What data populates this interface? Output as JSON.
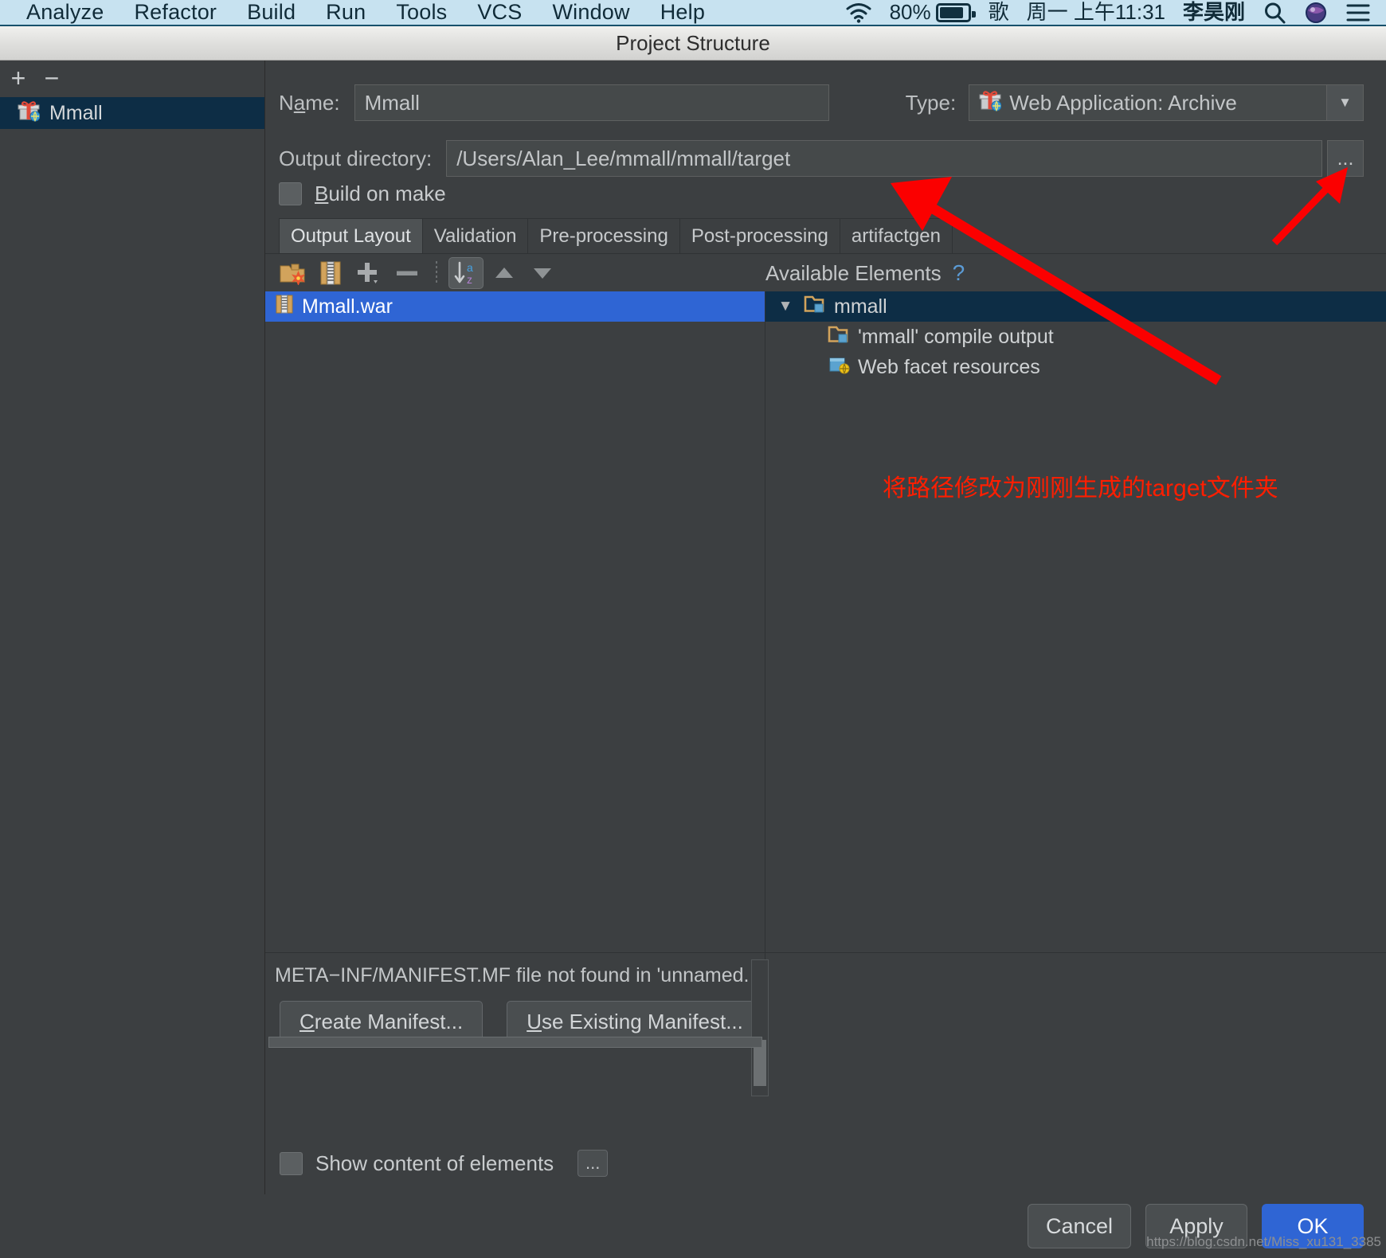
{
  "menubar": {
    "items": [
      {
        "label": "Analyze"
      },
      {
        "label": "Refactor"
      },
      {
        "label": "Build"
      },
      {
        "label": "Run"
      },
      {
        "label": "Tools"
      },
      {
        "label": "VCS"
      },
      {
        "label": "Window"
      },
      {
        "label": "Help"
      }
    ],
    "status": {
      "wifi_icon": "wifi-icon",
      "battery_percent": "80%",
      "battery_icon": "battery-icon",
      "input_method": "歌",
      "datetime": "周一 上午11:31",
      "user": "李昊刚",
      "search_icon": "search-icon",
      "siri_icon": "siri-icon",
      "control_center_icon": "control-center-icon"
    }
  },
  "dialog": {
    "title": "Project Structure",
    "sidebar": {
      "add_label": "+",
      "remove_label": "−",
      "items": [
        {
          "label": "Mmall",
          "icon": "artifact-gift-icon"
        }
      ]
    },
    "form": {
      "name_label_pre": "N",
      "name_label_mnemonic": "a",
      "name_label_post": "me:",
      "name_value": "Mmall",
      "type_label": "Type:",
      "type_value": "Web Application: Archive",
      "type_icon": "artifact-gift-icon",
      "dropdown_icon": "chevron-down-icon",
      "output_label": "Output directory:",
      "output_value": "/Users/Alan_Lee/mmall/mmall/target",
      "browse_label": "...",
      "build_on_make_pre": "",
      "build_on_make_mnemonic": "B",
      "build_on_make_post": "uild on make",
      "build_on_make_checked": false
    },
    "tabs": [
      {
        "label": "Output Layout",
        "active": true
      },
      {
        "label": "Validation",
        "active": false
      },
      {
        "label": "Pre-processing",
        "active": false
      },
      {
        "label": "Post-processing",
        "active": false
      },
      {
        "label": "artifactgen",
        "active": false
      }
    ],
    "toolbar": [
      {
        "name": "add-output-directory-icon",
        "label": ""
      },
      {
        "name": "add-archive-icon",
        "label": ""
      },
      {
        "name": "add-plus-icon",
        "label": ""
      },
      {
        "name": "remove-minus-icon",
        "label": ""
      },
      {
        "name": "sort-az-icon",
        "label": "",
        "active": true
      },
      {
        "name": "move-up-icon",
        "label": ""
      },
      {
        "name": "move-down-icon",
        "label": ""
      }
    ],
    "available_elements": {
      "title": "Available Elements",
      "help_icon": "help-question-icon"
    },
    "output_tree": [
      {
        "label": "Mmall.war",
        "icon": "archive-war-icon",
        "selected": true
      }
    ],
    "elements_tree": [
      {
        "label": "mmall",
        "icon": "module-folder-icon",
        "indent": 0,
        "expanded": true,
        "selected": true
      },
      {
        "label": "'mmall' compile output",
        "icon": "compile-output-folder-icon",
        "indent": 1,
        "expanded": false,
        "selected": false
      },
      {
        "label": "Web facet resources",
        "icon": "web-facet-icon",
        "indent": 1,
        "expanded": false,
        "selected": false
      }
    ],
    "manifest": {
      "message": "META−INF/MANIFEST.MF file not found in 'unnamed.",
      "create_label_mnemonic": "C",
      "create_label_rest": "reate Manifest...",
      "use_existing_mnemonic": "U",
      "use_existing_rest": "se Existing Manifest..."
    },
    "show_content": {
      "label": "Show content of elements",
      "checked": false,
      "dots_label": "..."
    },
    "buttons": [
      {
        "label": "Cancel",
        "primary": false
      },
      {
        "label": "Apply",
        "primary": false
      },
      {
        "label": "OK",
        "primary": true
      }
    ]
  },
  "annotations": {
    "note_text": "将路径修改为刚刚生成的target文件夹",
    "note_color": "#ff1e00",
    "arrow_color": "#fb0000",
    "watermark": "https://blog.csdn.net/Miss_xu131_3385"
  },
  "colors": {
    "menubar_bg": "#c7e2f0",
    "dialog_bg": "#3c3f41",
    "selection_blue": "#2f65d4",
    "selection_dark": "#0d2d45",
    "accent_link": "#5b9bd5"
  }
}
